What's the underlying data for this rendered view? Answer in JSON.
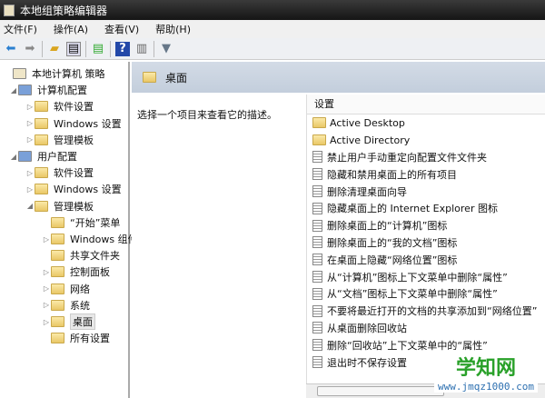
{
  "title": "本地组策略编辑器",
  "menu": [
    "文件(F)",
    "操作(A)",
    "查看(V)",
    "帮助(H)"
  ],
  "tree": [
    {
      "label": "本地计算机 策略",
      "level": 0,
      "tri": ""
    },
    {
      "label": "计算机配置",
      "level": 1,
      "tri": "◢"
    },
    {
      "label": "软件设置",
      "level": 2,
      "tri": "▷"
    },
    {
      "label": "Windows 设置",
      "level": 2,
      "tri": "▷"
    },
    {
      "label": "管理模板",
      "level": 2,
      "tri": "▷"
    },
    {
      "label": "用户配置",
      "level": 1,
      "tri": "◢"
    },
    {
      "label": "软件设置",
      "level": 2,
      "tri": "▷"
    },
    {
      "label": "Windows 设置",
      "level": 2,
      "tri": "▷"
    },
    {
      "label": "管理模板",
      "level": 2,
      "tri": "◢"
    },
    {
      "label": "“开始”菜单",
      "level": 3,
      "tri": ""
    },
    {
      "label": "Windows 组件",
      "level": 3,
      "tri": "▷"
    },
    {
      "label": "共享文件夹",
      "level": 3,
      "tri": ""
    },
    {
      "label": "控制面板",
      "level": 3,
      "tri": "▷"
    },
    {
      "label": "网络",
      "level": 3,
      "tri": "▷"
    },
    {
      "label": "系统",
      "level": 3,
      "tri": "▷"
    },
    {
      "label": "桌面",
      "level": 3,
      "tri": "▷",
      "selected": true
    },
    {
      "label": "所有设置",
      "level": 3,
      "tri": ""
    }
  ],
  "right": {
    "header": "桌面",
    "description": "选择一个项目来查看它的描述。",
    "column": "设置",
    "items": [
      {
        "label": "Active Desktop",
        "type": "folder"
      },
      {
        "label": "Active Directory",
        "type": "folder"
      },
      {
        "label": "禁止用户手动重定向配置文件文件夹",
        "type": "doc"
      },
      {
        "label": "隐藏和禁用桌面上的所有项目",
        "type": "doc"
      },
      {
        "label": "删除清理桌面向导",
        "type": "doc"
      },
      {
        "label": "隐藏桌面上的 Internet Explorer 图标",
        "type": "doc"
      },
      {
        "label": "删除桌面上的“计算机”图标",
        "type": "doc"
      },
      {
        "label": "删除桌面上的“我的文档”图标",
        "type": "doc"
      },
      {
        "label": "在桌面上隐藏“网络位置”图标",
        "type": "doc"
      },
      {
        "label": "从“计算机”图标上下文菜单中删除“属性”",
        "type": "doc"
      },
      {
        "label": "从“文档”图标上下文菜单中删除“属性”",
        "type": "doc"
      },
      {
        "label": "不要将最近打开的文档的共享添加到“网络位置”",
        "type": "doc"
      },
      {
        "label": "从桌面删除回收站",
        "type": "doc"
      },
      {
        "label": "删除“回收站”上下文菜单中的“属性”",
        "type": "doc"
      },
      {
        "label": "退出时不保存设置",
        "type": "doc"
      }
    ]
  },
  "watermark": {
    "name": "学知网",
    "url": "www.jmqz1000.com"
  }
}
